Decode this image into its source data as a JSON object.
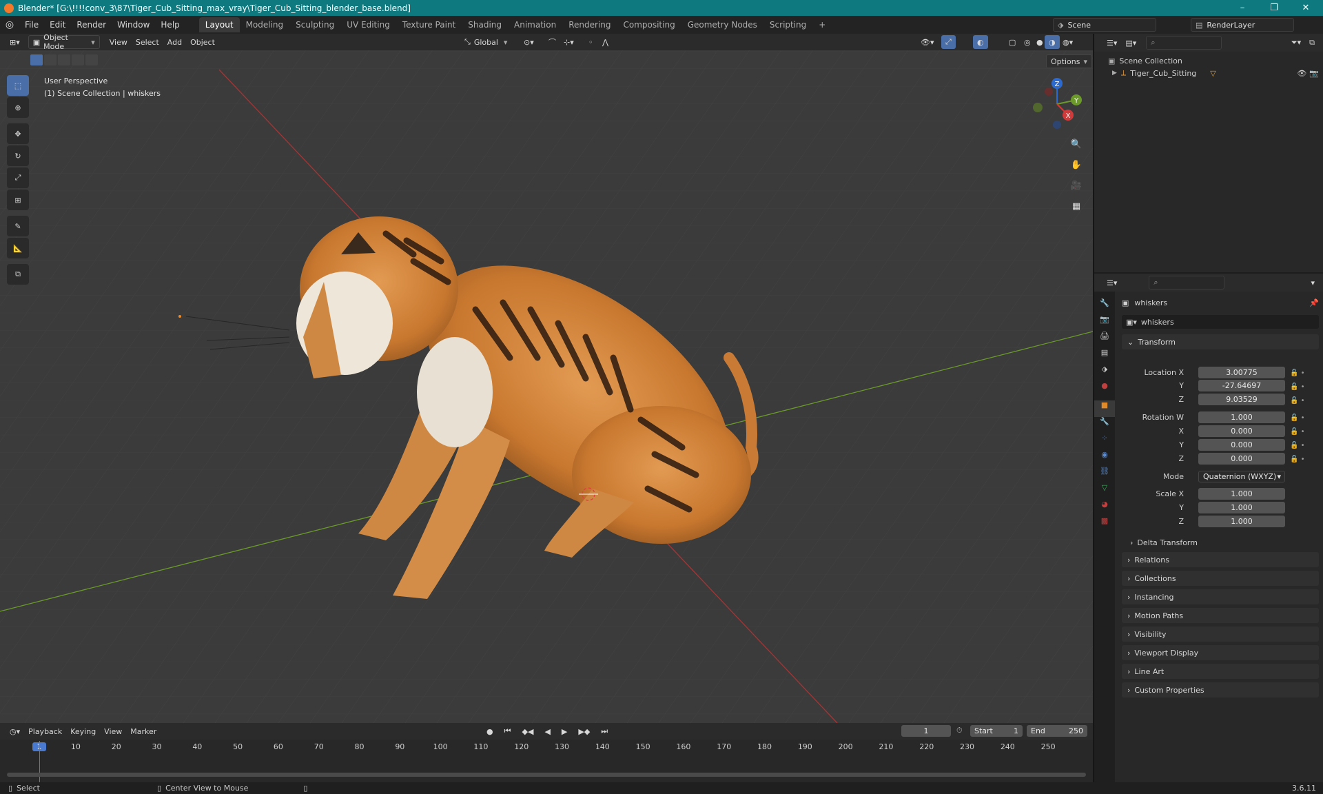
{
  "titlebar": {
    "title": "Blender* [G:\\!!!!conv_3\\87\\Tiger_Cub_Sitting_max_vray\\Tiger_Cub_Sitting_blender_base.blend]",
    "minimize": "–",
    "maximize": "❐",
    "close": "✕"
  },
  "menubar": {
    "menus": [
      "File",
      "Edit",
      "Render",
      "Window",
      "Help"
    ],
    "workspaces": [
      "Layout",
      "Modeling",
      "Sculpting",
      "UV Editing",
      "Texture Paint",
      "Shading",
      "Animation",
      "Rendering",
      "Compositing",
      "Geometry Nodes",
      "Scripting"
    ],
    "add_tab": "+",
    "scene": "Scene",
    "render_layer": "RenderLayer"
  },
  "viewport": {
    "mode": "Object Mode",
    "menus": [
      "View",
      "Select",
      "Add",
      "Object"
    ],
    "orientation": "Global",
    "options": "Options",
    "info_line1": "User Perspective",
    "info_line2": "(1) Scene Collection | whiskers",
    "gizmo": {
      "z": "Z",
      "y": "Y",
      "x": "X"
    }
  },
  "outliner": {
    "search_placeholder": "",
    "root": "Scene Collection",
    "items": [
      {
        "label": "Tiger_Cub_Sitting"
      }
    ]
  },
  "properties": {
    "search_placeholder": "",
    "object_name": "whiskers",
    "data_name": "whiskers",
    "transform_label": "Transform",
    "location": {
      "label": "Location X",
      "x": "3.00775",
      "y": "-27.64697",
      "z": "9.03529"
    },
    "rotation": {
      "label": "Rotation W",
      "w": "1.000",
      "x": "0.000",
      "y": "0.000",
      "z": "0.000"
    },
    "mode": {
      "label": "Mode",
      "value": "Quaternion (WXYZ)"
    },
    "scale": {
      "label": "Scale X",
      "x": "1.000",
      "y": "1.000",
      "z": "1.000"
    },
    "axis_y": "Y",
    "axis_z": "Z",
    "axis_x": "X",
    "delta": "Delta Transform",
    "panels": [
      "Relations",
      "Collections",
      "Instancing",
      "Motion Paths",
      "Visibility",
      "Viewport Display",
      "Line Art",
      "Custom Properties"
    ]
  },
  "timeline": {
    "menus": [
      "Playback",
      "Keying",
      "View",
      "Marker"
    ],
    "current_frame": "1",
    "start_label": "Start",
    "start": "1",
    "end_label": "End",
    "end": "250",
    "ticks": [
      "1",
      "10",
      "20",
      "30",
      "40",
      "50",
      "60",
      "70",
      "80",
      "90",
      "100",
      "110",
      "120",
      "130",
      "140",
      "150",
      "160",
      "170",
      "180",
      "190",
      "200",
      "210",
      "220",
      "230",
      "240",
      "250"
    ]
  },
  "statusbar": {
    "select": "Select",
    "center": "Center View to Mouse",
    "version": "3.6.11"
  },
  "colors": {
    "accent": "#4a6ea8",
    "titlebar": "#0e7a7f",
    "x_axis": "#b03535",
    "y_axis": "#6b9a2a"
  }
}
